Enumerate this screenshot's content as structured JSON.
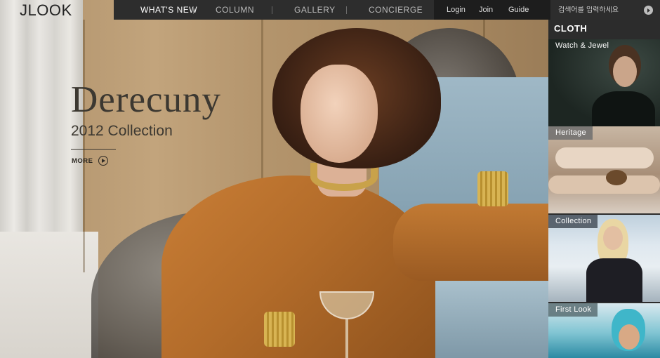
{
  "brand": {
    "logo": "JLOOK"
  },
  "nav": {
    "items": [
      {
        "label": "WHAT'S NEW",
        "active": true
      },
      {
        "label": "COLUMN",
        "active": false
      },
      {
        "label": "GALLERY",
        "active": false
      },
      {
        "label": "CONCIERGE",
        "active": false
      }
    ],
    "util": [
      "Login",
      "Join",
      "Guide"
    ],
    "search": {
      "placeholder": "검색어를 입력하세요",
      "button_icon": "arrow-right-circle-icon"
    }
  },
  "hero": {
    "title": "Derecuny",
    "subtitle": "2012 Collection",
    "more_label": "MORE",
    "more_icon": "play-circle-icon"
  },
  "sidebar": {
    "heading": "CLOTH",
    "cards": [
      {
        "label": "Watch & Jewel"
      },
      {
        "label": "Heritage"
      },
      {
        "label": "Collection"
      },
      {
        "label": "First Look"
      }
    ]
  },
  "colors": {
    "topbar": "#2d2d2d",
    "util_bar": "#1d1d1d",
    "nav_text": "#b9b9b9",
    "nav_active": "#ffffff",
    "hero_text": "#3c3831",
    "card_label_bg": "#6e6e6e"
  }
}
